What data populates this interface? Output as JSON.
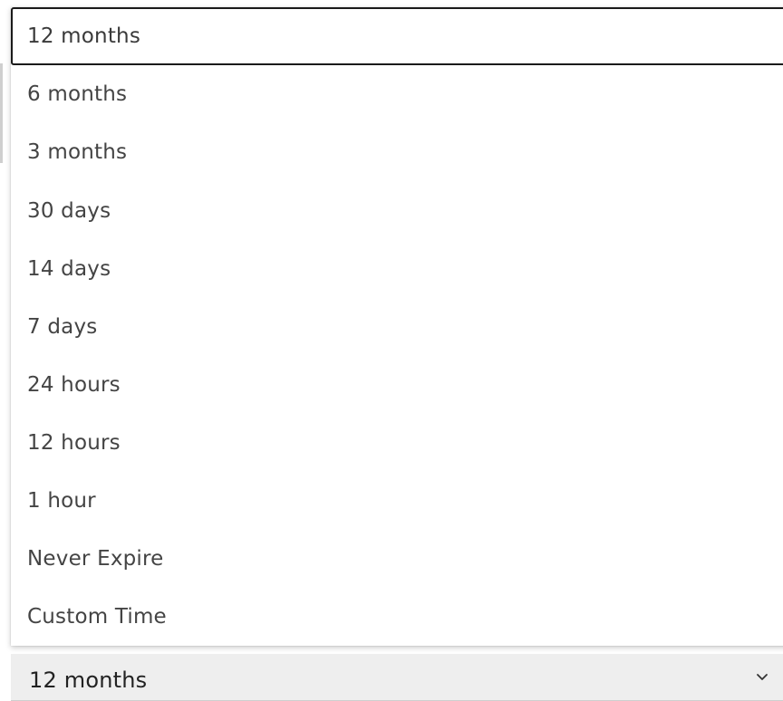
{
  "select": {
    "value": "12 months",
    "chevron_icon": "chevron-down-icon"
  },
  "dropdown": {
    "options": [
      {
        "label": "12 months",
        "selected": true
      },
      {
        "label": "6 months"
      },
      {
        "label": "3 months"
      },
      {
        "label": "30 days"
      },
      {
        "label": "14 days"
      },
      {
        "label": "7 days"
      },
      {
        "label": "24 hours"
      },
      {
        "label": "12 hours"
      },
      {
        "label": "1 hour"
      },
      {
        "label": "Never Expire"
      },
      {
        "label": "Custom Time"
      }
    ]
  }
}
